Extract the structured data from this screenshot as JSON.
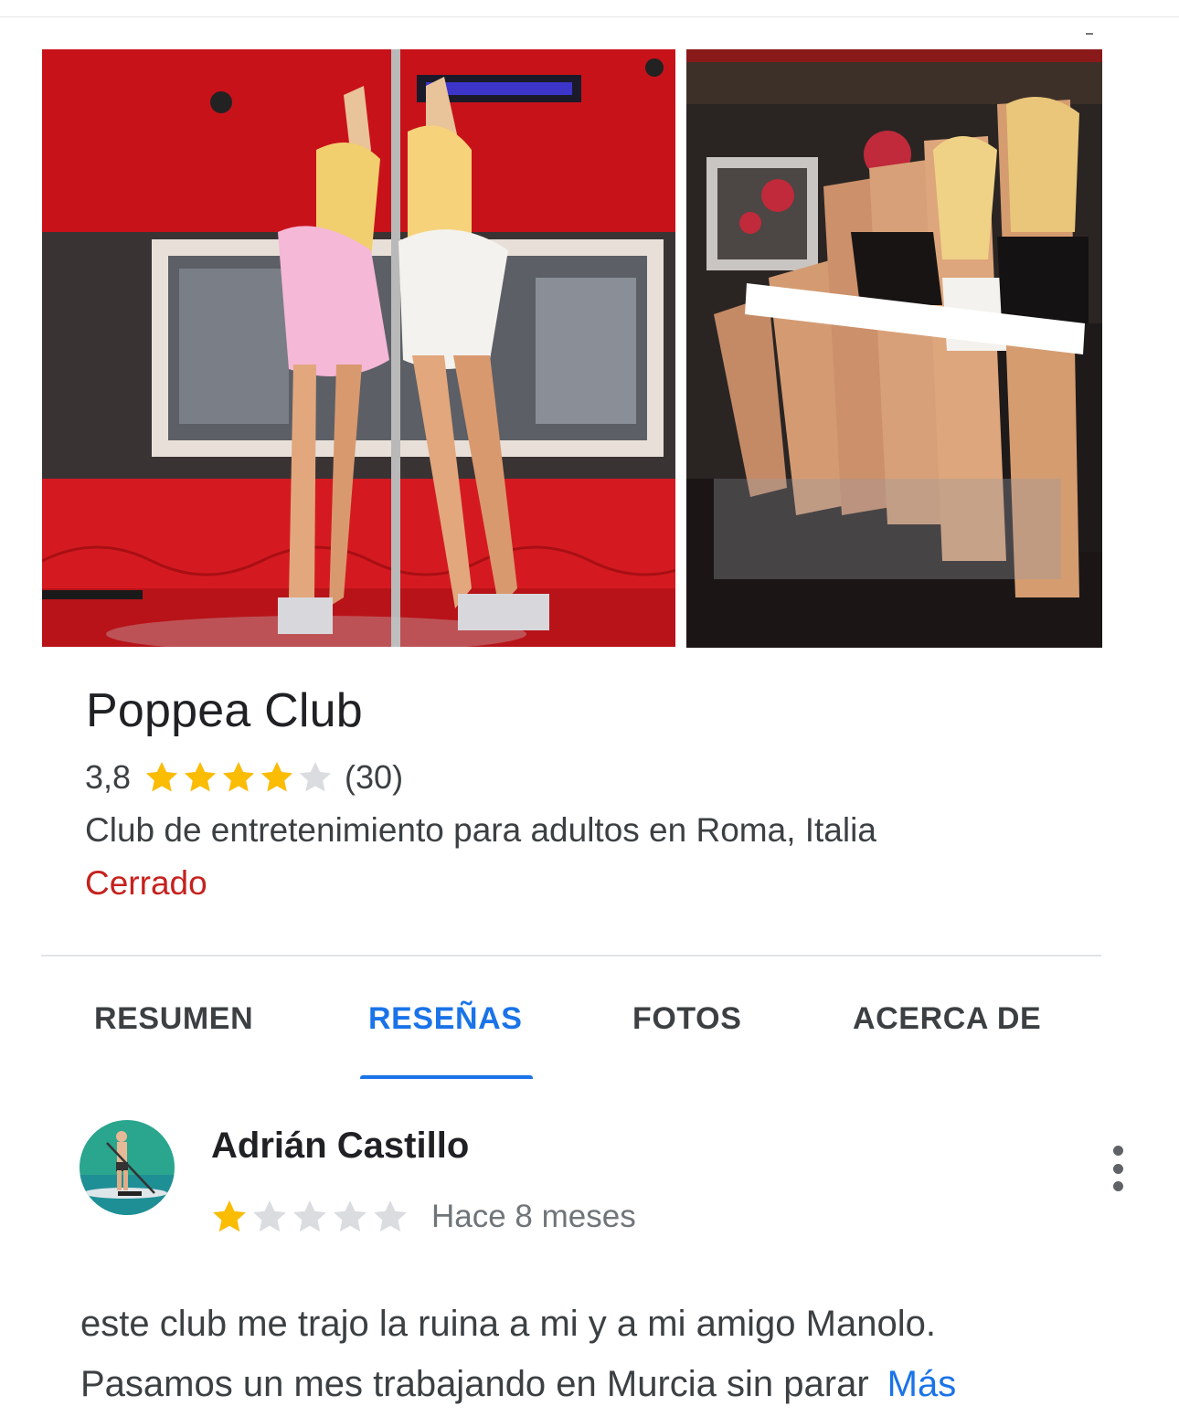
{
  "photos": [
    {
      "name": "photo-pole-dancers",
      "scene": "dancers-at-pole-red-room"
    },
    {
      "name": "photo-dancers-at-bar",
      "scene": "dancers-at-bar-dark-room"
    }
  ],
  "place": {
    "name": "Poppea Club",
    "rating": "3,8",
    "rating_value": 3.8,
    "rating_max": 5,
    "review_count": "(30)",
    "category": "Club de entretenimiento para adultos en Roma, Italia",
    "status": "Cerrado",
    "status_color": "#c5221f"
  },
  "tabs": [
    {
      "label": "RESUMEN",
      "active": false
    },
    {
      "label": "RESEÑAS",
      "active": true
    },
    {
      "label": "FOTOS",
      "active": false
    },
    {
      "label": "ACERCA DE",
      "active": false
    }
  ],
  "review": {
    "author": "Adrián Castillo",
    "rating_value": 1,
    "rating_max": 5,
    "time": "Hace 8 meses",
    "text_line1": "este club me trajo la ruina a mi y a mi amigo Manolo.",
    "text_line2": "Pasamos un mes trabajando en Murcia sin parar",
    "more": "Más",
    "menu_icon": "more-vert-icon",
    "avatar_icon": "paddleboarder-avatar"
  },
  "colors": {
    "accent": "#1a73e8",
    "star_filled": "#fbbc04",
    "star_empty": "#dadce0",
    "text": "#202124",
    "secondary_text": "#70757a"
  }
}
